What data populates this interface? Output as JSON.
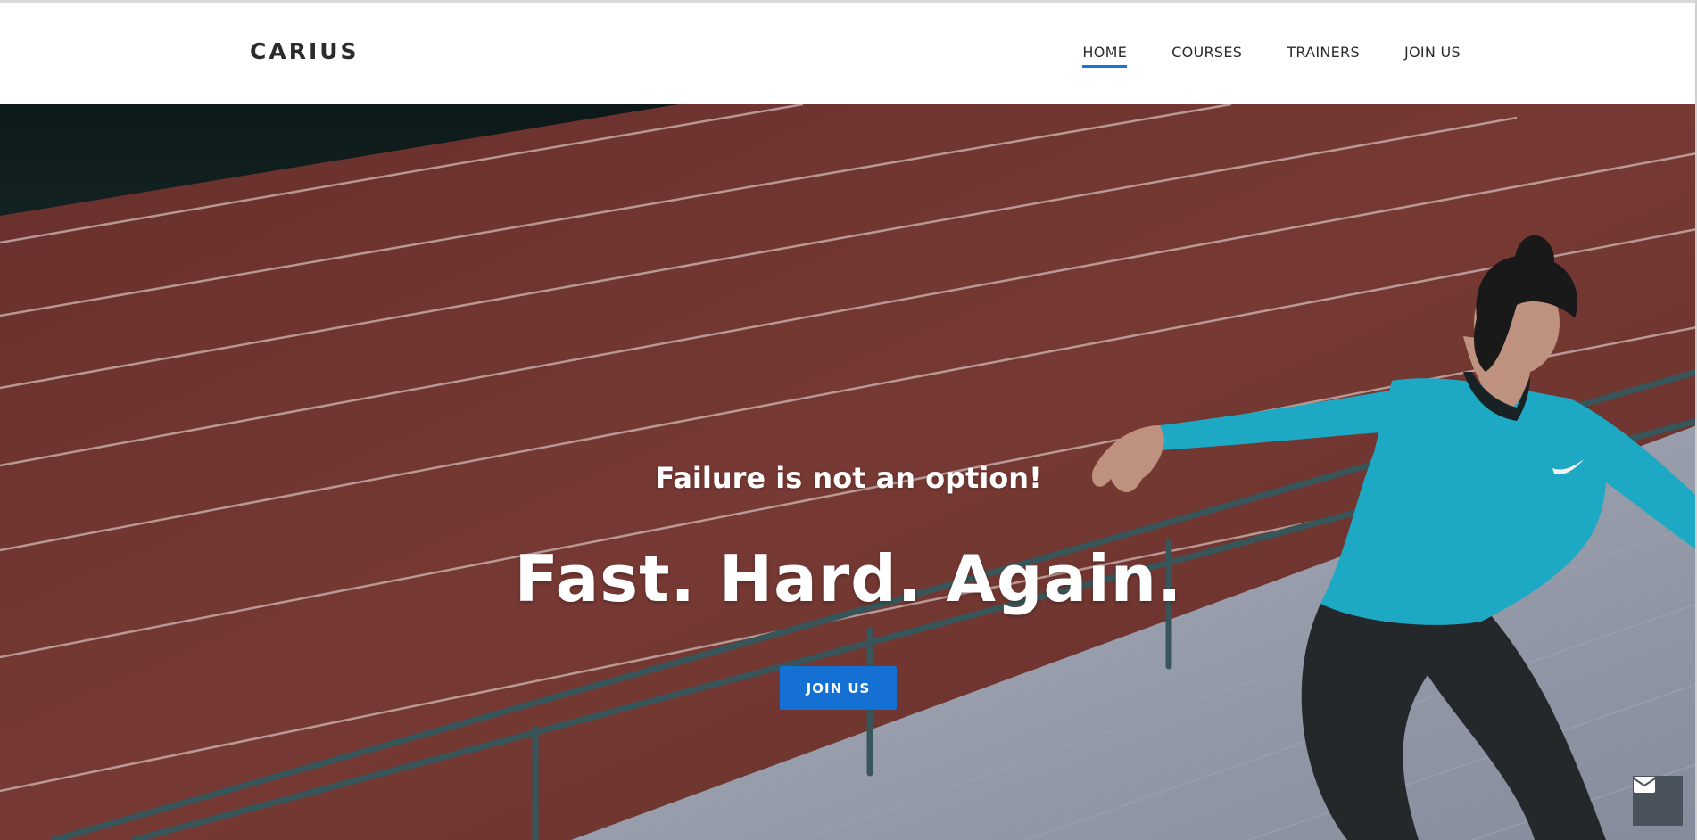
{
  "brand": {
    "logo": "CARIUS"
  },
  "nav": {
    "items": [
      {
        "label": "HOME",
        "active": true
      },
      {
        "label": "COURSES",
        "active": false
      },
      {
        "label": "TRAINERS",
        "active": false
      },
      {
        "label": "JOIN US",
        "active": false
      }
    ]
  },
  "hero": {
    "tagline": "Failure is not an option!",
    "headline": "Fast. Hard. Again.",
    "cta_label": "JOIN US"
  },
  "floating": {
    "icon": "envelope-icon"
  },
  "colors": {
    "accent": "#1470d2",
    "track": "#7a3a35",
    "shirt": "#1fb3cf"
  }
}
